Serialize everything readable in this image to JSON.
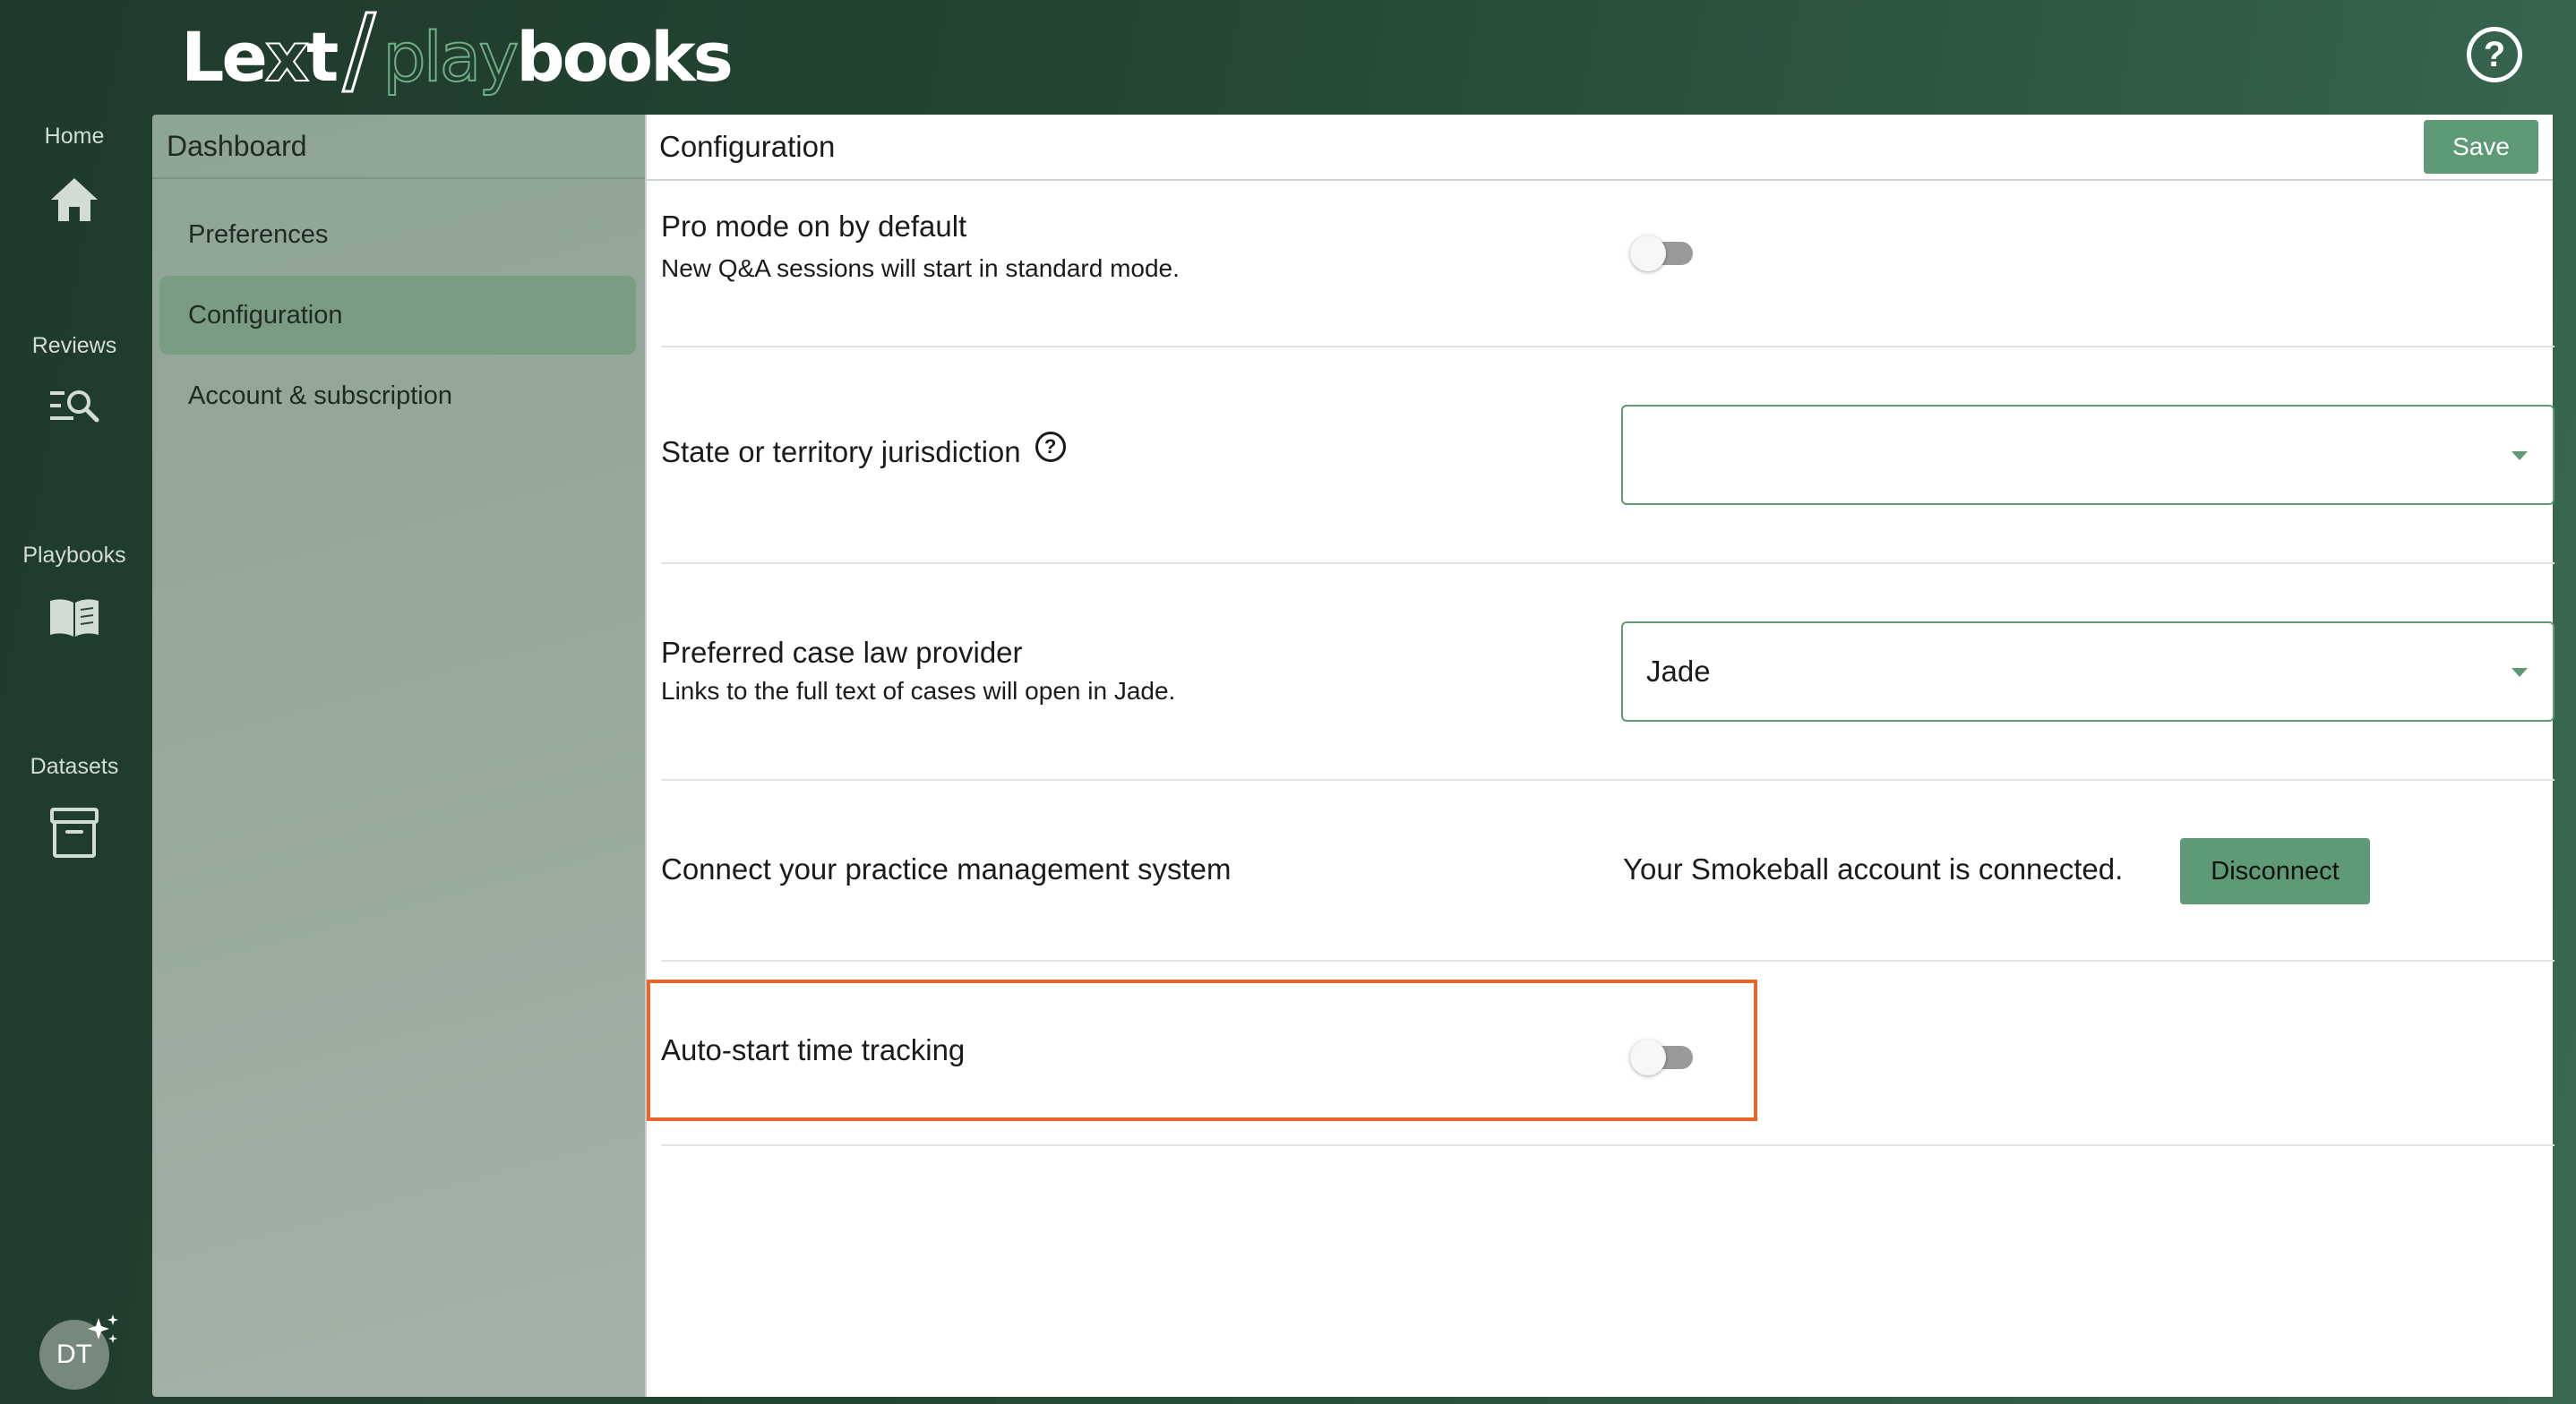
{
  "app": {
    "logo": {
      "part1": "Le",
      "part2": "x",
      "part3": "t",
      "part4": "play",
      "part5": "books"
    },
    "help_icon": "question-circle-icon"
  },
  "nav": {
    "items": [
      {
        "label": "Home",
        "icon": "home-icon"
      },
      {
        "label": "Reviews",
        "icon": "search-list-icon"
      },
      {
        "label": "Playbooks",
        "icon": "book-icon"
      },
      {
        "label": "Datasets",
        "icon": "archive-box-icon"
      }
    ],
    "avatar_initials": "DT"
  },
  "sidebar": {
    "title": "Dashboard",
    "items": [
      {
        "label": "Preferences",
        "active": false
      },
      {
        "label": "Configuration",
        "active": true
      },
      {
        "label": "Account & subscription",
        "active": false
      }
    ]
  },
  "main": {
    "title": "Configuration",
    "save_label": "Save",
    "settings": {
      "pro_mode": {
        "title": "Pro mode on by default",
        "subtitle": "New Q&A sessions will start in standard mode.",
        "enabled": false
      },
      "jurisdiction": {
        "title": "State or territory jurisdiction",
        "value": ""
      },
      "case_law": {
        "title": "Preferred case law provider",
        "subtitle": "Links to the full text of cases will open in Jade.",
        "value": "Jade"
      },
      "practice_mgmt": {
        "title": "Connect your practice management system",
        "status": "Your Smokeball account is connected.",
        "button_label": "Disconnect"
      },
      "time_tracking": {
        "title": "Auto-start time tracking",
        "enabled": false
      }
    }
  },
  "colors": {
    "accent": "#5e9a76",
    "highlight": "#e8662a"
  }
}
